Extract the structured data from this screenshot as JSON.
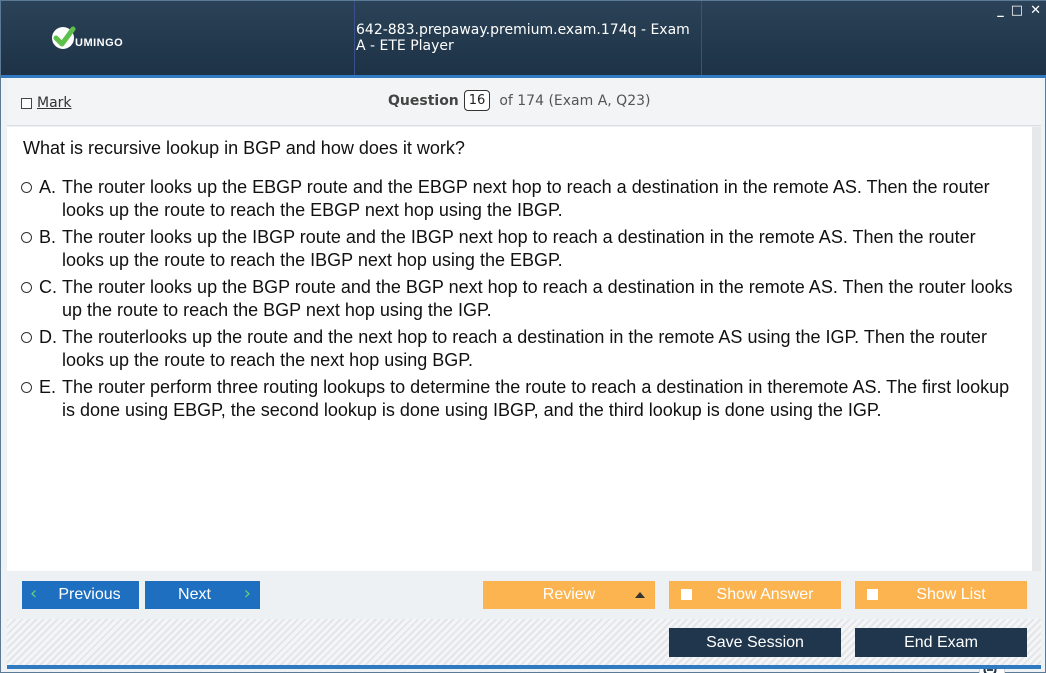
{
  "app": {
    "logo_text": "UMINGO",
    "window_title": "642-883.prepaway.premium.exam.174q - Exam A - ETE Player",
    "window_controls": {
      "minimize": "_",
      "maximize": "□",
      "close": "✕"
    }
  },
  "header": {
    "mark_label": "Mark",
    "question_label": "Question",
    "question_number": "16",
    "question_total": "of 174 (Exam A, Q23)"
  },
  "question": {
    "text": "What is recursive lookup in BGP and how does it work?",
    "options": [
      {
        "letter": "A.",
        "text": "The router looks up the EBGP route and the EBGP next hop to reach a destination in the remote AS. Then the router looks up the route to reach the EBGP next hop using the IBGP."
      },
      {
        "letter": "B.",
        "text": "The router looks up the IBGP route and the IBGP next hop to reach a destination in the remote AS. Then the router looks up the route to reach the IBGP next hop using the EBGP."
      },
      {
        "letter": "C.",
        "text": "The router looks up the BGP route and the BGP next hop to reach a destination in the remote AS. Then the router looks up the route to reach the BGP next hop using the IGP."
      },
      {
        "letter": "D.",
        "text": "The routerlooks up the route and the next hop to reach a destination in the remote AS using the IGP. Then the router looks up the route to reach the next hop using BGP."
      },
      {
        "letter": "E.",
        "text": "The router perform three routing lookups to determine the route to reach a destination in theremote AS. The first lookup is done using EBGP, the second lookup is done using IBGP, and the third lookup is done using the IGP."
      }
    ]
  },
  "zoom": {
    "icons": [
      "search-icon",
      "zoom-in-icon",
      "zoom-out-icon"
    ]
  },
  "nav": {
    "previous_label": "Previous",
    "next_label": "Next",
    "review_label": "Review",
    "show_answer_label": "Show Answer",
    "show_list_label": "Show List"
  },
  "footer": {
    "save_session_label": "Save Session",
    "end_exam_label": "End Exam"
  },
  "colors": {
    "titlebar": "#1d3245",
    "accent_blue": "#1e6fc0",
    "accent_orange": "#fbb450",
    "footer_button": "#1f364c",
    "chevron_green": "#5fd47a"
  }
}
